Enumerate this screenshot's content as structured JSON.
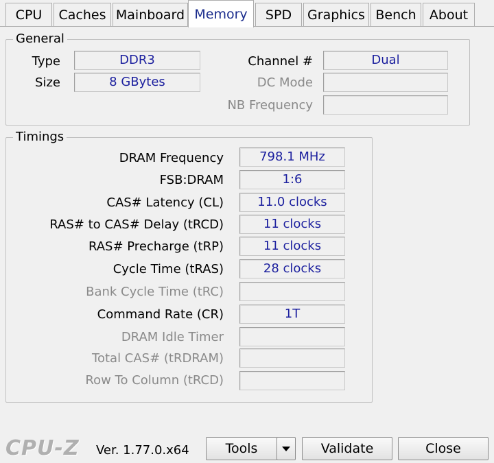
{
  "tabs": [
    {
      "label": "CPU"
    },
    {
      "label": "Caches"
    },
    {
      "label": "Mainboard"
    },
    {
      "label": "Memory",
      "active": true
    },
    {
      "label": "SPD"
    },
    {
      "label": "Graphics"
    },
    {
      "label": "Bench"
    },
    {
      "label": "About"
    }
  ],
  "general": {
    "title": "General",
    "type_label": "Type",
    "type_value": "DDR3",
    "size_label": "Size",
    "size_value": "8 GBytes",
    "channel_label": "Channel #",
    "channel_value": "Dual",
    "dc_mode_label": "DC Mode",
    "dc_mode_value": "",
    "nb_freq_label": "NB Frequency",
    "nb_freq_value": ""
  },
  "timings": {
    "title": "Timings",
    "rows": [
      {
        "label": "DRAM Frequency",
        "value": "798.1 MHz"
      },
      {
        "label": "FSB:DRAM",
        "value": "1:6"
      },
      {
        "label": "CAS# Latency (CL)",
        "value": "11.0 clocks"
      },
      {
        "label": "RAS# to CAS# Delay (tRCD)",
        "value": "11 clocks"
      },
      {
        "label": "RAS# Precharge (tRP)",
        "value": "11 clocks"
      },
      {
        "label": "Cycle Time (tRAS)",
        "value": "28 clocks"
      },
      {
        "label": "Bank Cycle Time (tRC)",
        "value": ""
      },
      {
        "label": "Command Rate (CR)",
        "value": "1T"
      },
      {
        "label": "DRAM Idle Timer",
        "value": ""
      },
      {
        "label": "Total CAS# (tRDRAM)",
        "value": ""
      },
      {
        "label": "Row To Column (tRCD)",
        "value": ""
      }
    ]
  },
  "footer": {
    "logo": "CPU-Z",
    "version": "Ver. 1.77.0.x64",
    "tools_label": "Tools",
    "validate_label": "Validate",
    "close_label": "Close"
  },
  "colors": {
    "value_text": "#1b1f9e",
    "active_tab_text": "#1a2c8c",
    "disabled_label": "#8a8a8a"
  }
}
